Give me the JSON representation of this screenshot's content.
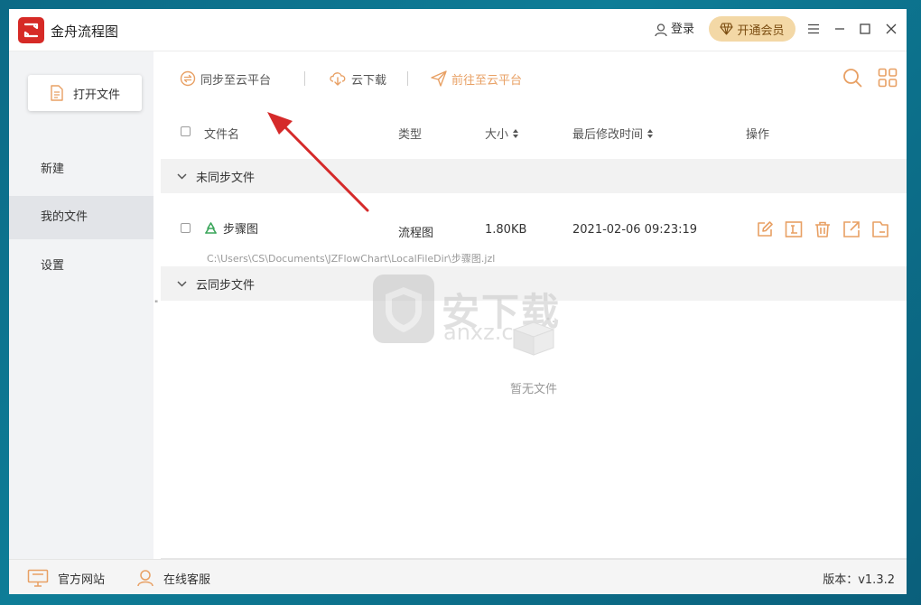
{
  "app": {
    "title": "金舟流程图"
  },
  "titlebar": {
    "login": "登录",
    "vip": "开通会员"
  },
  "sidebar": {
    "open_file": "打开文件",
    "items": [
      {
        "label": "新建"
      },
      {
        "label": "我的文件"
      },
      {
        "label": "设置"
      }
    ]
  },
  "toolbar": {
    "sync": "同步至云平台",
    "download": "云下载",
    "goto": "前往至云平台",
    "accent_color": "#e8a064"
  },
  "table": {
    "headers": {
      "name": "文件名",
      "type": "类型",
      "size": "大小",
      "modified": "最后修改时间",
      "actions": "操作"
    }
  },
  "groups": {
    "unsynced": "未同步文件",
    "synced": "云同步文件"
  },
  "files": [
    {
      "name": "步骤图",
      "type": "流程图",
      "size": "1.80KB",
      "modified": "2021-02-06 09:23:19",
      "path": "C:\\Users\\CS\\Documents\\JZFlowChart\\LocalFileDir\\步骤图.jzl"
    }
  ],
  "empty": {
    "text": "暂无文件"
  },
  "watermark": {
    "text": "安下载",
    "sub": "anxz.com"
  },
  "footer": {
    "website": "官方网站",
    "service": "在线客服",
    "version": "版本：v1.3.2"
  }
}
